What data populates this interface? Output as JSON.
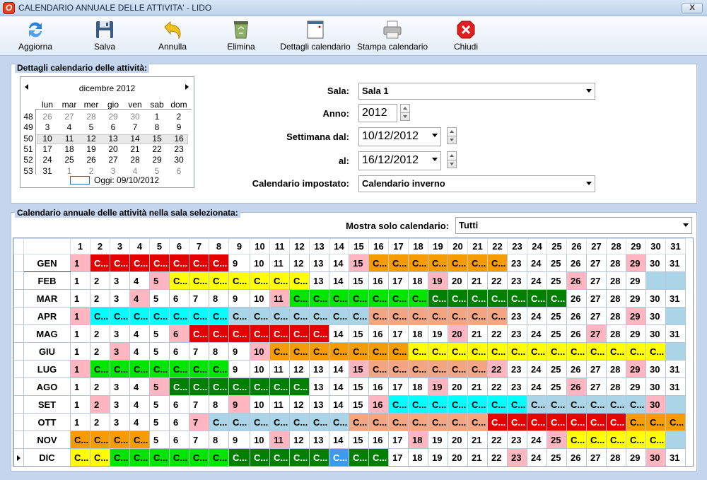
{
  "window": {
    "title": "CALENDARIO ANNUALE DELLE ATTIVITA' - LIDO",
    "close_label": "X"
  },
  "toolbar": [
    {
      "label": "Aggiorna",
      "icon": "refresh-icon"
    },
    {
      "label": "Salva",
      "icon": "floppy-disk-icon"
    },
    {
      "label": "Annulla",
      "icon": "undo-arrow-icon"
    },
    {
      "label": "Elimina",
      "icon": "recycle-bin-icon"
    },
    {
      "label": "Dettagli calendario",
      "icon": "calendar-window-icon"
    },
    {
      "label": "Stampa calendario",
      "icon": "printer-icon"
    },
    {
      "label": "Chiudi",
      "icon": "close-x-icon"
    }
  ],
  "details": {
    "legend": "Dettagli calendario delle attività:",
    "month_label": "dicembre 2012",
    "weekdays": [
      "lun",
      "mar",
      "mer",
      "gio",
      "ven",
      "sab",
      "dom"
    ],
    "weeks": [
      {
        "wk": "48",
        "days": [
          "26",
          "27",
          "28",
          "29",
          "30",
          "1",
          "2"
        ],
        "other": [
          1,
          1,
          1,
          1,
          1,
          0,
          0
        ]
      },
      {
        "wk": "49",
        "days": [
          "3",
          "4",
          "5",
          "6",
          "7",
          "8",
          "9"
        ],
        "other": [
          0,
          0,
          0,
          0,
          0,
          0,
          0
        ]
      },
      {
        "wk": "50",
        "days": [
          "10",
          "11",
          "12",
          "13",
          "14",
          "15",
          "16"
        ],
        "other": [
          0,
          0,
          0,
          0,
          0,
          0,
          0
        ]
      },
      {
        "wk": "51",
        "days": [
          "17",
          "18",
          "19",
          "20",
          "21",
          "22",
          "23"
        ],
        "other": [
          0,
          0,
          0,
          0,
          0,
          0,
          0
        ]
      },
      {
        "wk": "52",
        "days": [
          "24",
          "25",
          "26",
          "27",
          "28",
          "29",
          "30"
        ],
        "other": [
          0,
          0,
          0,
          0,
          0,
          0,
          0
        ]
      },
      {
        "wk": "53",
        "days": [
          "31",
          "1",
          "2",
          "3",
          "4",
          "5",
          "6"
        ],
        "other": [
          0,
          1,
          1,
          1,
          1,
          1,
          1
        ]
      }
    ],
    "selected_week": "50",
    "today_label": "Oggi: 09/10/2012",
    "sala_label": "Sala:",
    "sala_value": "Sala 1",
    "anno_label": "Anno:",
    "anno_value": "2012",
    "settimana_label": "Settimana dal:",
    "settimana_value": "10/12/2012",
    "al_label": "al:",
    "al_value": "16/12/2012",
    "impostato_label": "Calendario impostato:",
    "impostato_value": "Calendario inverno"
  },
  "annual": {
    "legend": "Calendario annuale delle attività nella sala selezionata:",
    "filter_label": "Mostra solo calendario:",
    "filter_value": "Tutti",
    "colors": {
      "r": "#e50000",
      "o": "#f49c00",
      "y": "#ffff00",
      "g": "#00e600",
      "dg": "#008000",
      "c": "#00ffff",
      "lb": "#a9d5e6",
      "s": "#f4a582",
      "p": "#ffb6c1",
      "b": "#3b9bf0",
      "w": "#ffffff"
    },
    "day_headers": [
      "1",
      "2",
      "3",
      "4",
      "5",
      "6",
      "7",
      "8",
      "9",
      "10",
      "11",
      "12",
      "13",
      "14",
      "15",
      "16",
      "17",
      "18",
      "19",
      "20",
      "21",
      "22",
      "23",
      "24",
      "25",
      "26",
      "27",
      "28",
      "29",
      "30",
      "31"
    ],
    "months": [
      {
        "name": "GEN",
        "days": 31,
        "marked": true,
        "cells": "p r r r r r r r w w w w w w p o o o o o o o w w w w w w p w w"
      },
      {
        "name": "FEB",
        "days": 29,
        "cells": "w w w w p y y y y y y y w w w w w w p w w w w w w p w w w"
      },
      {
        "name": "MAR",
        "days": 31,
        "cells": "w w w p w w w w w w p g g g g g g g dg dg dg dg dg dg dg w w w w w w"
      },
      {
        "name": "APR",
        "days": 30,
        "cells": "p c c c c c c c lb lb lb lb lb lb lb s s s s s s s w w w w w w p w"
      },
      {
        "name": "MAG",
        "days": 31,
        "cells": "w w w w w p r r r r r r r w w w w w w p w w w w w w p w w w w"
      },
      {
        "name": "GIU",
        "days": 30,
        "cells": "w w p w w w w w w p o o o o o o o y y y y y y y y y y y y y"
      },
      {
        "name": "LUG",
        "days": 31,
        "cells": "p g g g g g g g w w w w w w p s s s s s s p w w w w w w p w w"
      },
      {
        "name": "AGO",
        "days": 31,
        "cells": "w w w w p dg dg dg dg dg dg dg w w w w w w p w w w w w w p w w w w w"
      },
      {
        "name": "SET",
        "days": 30,
        "cells": "w p w w w w w w p w w w w w w p c c c c c c c lb lb lb lb lb lb p"
      },
      {
        "name": "OTT",
        "days": 31,
        "cells": "w w w w w w p lb lb lb lb lb lb lb s s s s s s s r r r r r r r o o o"
      },
      {
        "name": "NOV",
        "days": 30,
        "cells": "o o o o w w w w w w p w w w w w w p w w w w w w p y y y y y"
      },
      {
        "name": "DIC",
        "days": 31,
        "current": true,
        "cells": "y y g g g g g g dg dg dg dg dg b dg dg w w w w w w p w w w w w w p w"
      }
    ]
  }
}
